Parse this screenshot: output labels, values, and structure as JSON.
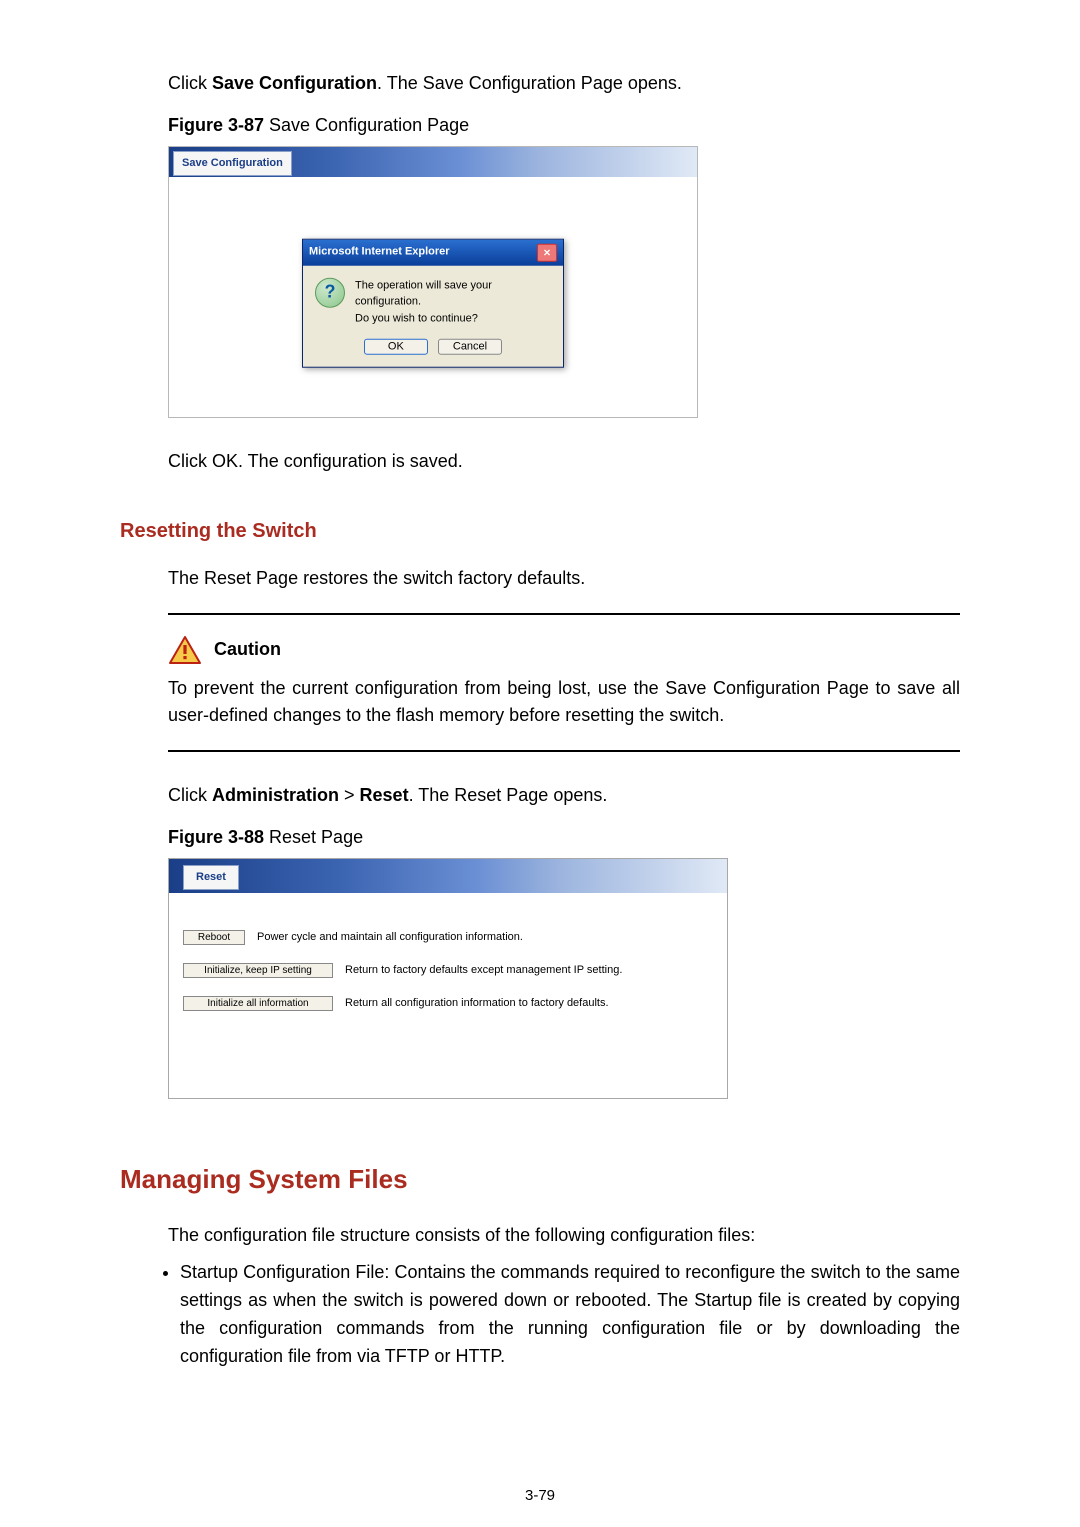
{
  "intro": {
    "click_save": "Click ",
    "save_config_bold": "Save Configuration",
    "click_save_after": ". The Save Configuration Page opens."
  },
  "fig87": {
    "caption_prefix": "Figure 3-87 ",
    "caption": "Save Configuration Page",
    "tab": "Save Configuration",
    "dialog": {
      "title": "Microsoft Internet Explorer",
      "line1": "The operation will save your configuration.",
      "line2": "Do you wish to continue?",
      "ok": "OK",
      "cancel": "Cancel"
    }
  },
  "after_fig87": "Click OK. The configuration is saved.",
  "reset_heading": "Resetting the Switch",
  "reset_p1": "The Reset Page restores the switch factory defaults.",
  "caution_label": "Caution",
  "caution_text": "To prevent the current configuration from being lost, use the Save Configuration Page to save all user-defined changes to the flash memory before resetting the switch.",
  "click_reset": {
    "pre": "Click ",
    "admin": "Administration",
    "sep": " > ",
    "reset": "Reset",
    "post": ". The Reset Page opens."
  },
  "fig88": {
    "caption_prefix": "Figure 3-88 ",
    "caption": "Reset Page",
    "tab": "Reset",
    "rows": [
      {
        "btn": "Reboot",
        "desc": "Power cycle and maintain all configuration information."
      },
      {
        "btn": "Initialize, keep IP setting",
        "desc": "Return to factory defaults except management IP setting."
      },
      {
        "btn": "Initialize all information",
        "desc": "Return all configuration information to factory defaults."
      }
    ]
  },
  "files_heading": "Managing System Files",
  "files_intro": "The configuration file structure consists of the following configuration files:",
  "files_bullet1": "Startup Configuration File: Contains the commands required to reconfigure the switch to the same settings as when the switch is powered down or rebooted. The Startup file is created by copying the configuration commands from the running configuration file or by downloading the configuration file from via TFTP or HTTP.",
  "page_number": "3-79"
}
